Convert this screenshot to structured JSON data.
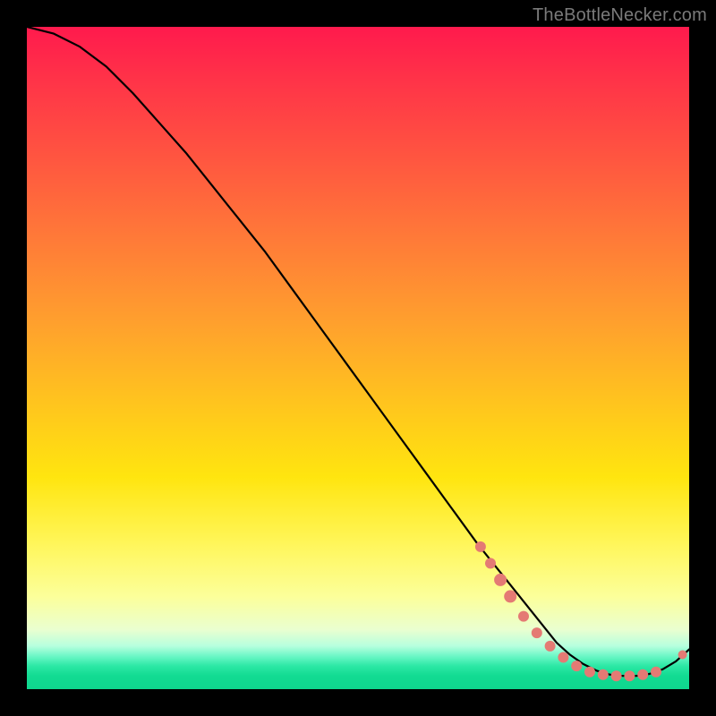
{
  "watermark": "TheBottleNecker.com",
  "colors": {
    "curve": "#000000",
    "marker_fill": "#e47a74",
    "marker_stroke": "#c95b55"
  },
  "chart_data": {
    "type": "line",
    "title": "",
    "xlabel": "",
    "ylabel": "",
    "xlim": [
      0,
      100
    ],
    "ylim": [
      0,
      100
    ],
    "grid": false,
    "legend": false,
    "series": [
      {
        "name": "curve",
        "x": [
          0,
          4,
          8,
          12,
          16,
          20,
          24,
          28,
          32,
          36,
          40,
          44,
          48,
          52,
          56,
          60,
          64,
          68,
          72,
          76,
          80,
          82,
          84,
          86,
          88,
          90,
          92,
          94,
          96,
          98,
          100
        ],
        "values": [
          100,
          99,
          97,
          94,
          90,
          85.5,
          81,
          76,
          71,
          66,
          60.5,
          55,
          49.5,
          44,
          38.5,
          33,
          27.5,
          22,
          17,
          12,
          7,
          5.2,
          3.8,
          2.8,
          2.2,
          2.0,
          2.0,
          2.3,
          3.0,
          4.2,
          6.0
        ]
      }
    ],
    "markers": [
      {
        "x": 68.5,
        "y": 21.5,
        "r": 6
      },
      {
        "x": 70.0,
        "y": 19.0,
        "r": 6
      },
      {
        "x": 71.5,
        "y": 16.5,
        "r": 7
      },
      {
        "x": 73.0,
        "y": 14.0,
        "r": 7
      },
      {
        "x": 75.0,
        "y": 11.0,
        "r": 6
      },
      {
        "x": 77.0,
        "y": 8.5,
        "r": 6
      },
      {
        "x": 79.0,
        "y": 6.5,
        "r": 6
      },
      {
        "x": 81.0,
        "y": 4.8,
        "r": 6
      },
      {
        "x": 83.0,
        "y": 3.5,
        "r": 6
      },
      {
        "x": 85.0,
        "y": 2.6,
        "r": 6
      },
      {
        "x": 87.0,
        "y": 2.2,
        "r": 6
      },
      {
        "x": 89.0,
        "y": 2.0,
        "r": 6
      },
      {
        "x": 91.0,
        "y": 2.0,
        "r": 6
      },
      {
        "x": 93.0,
        "y": 2.2,
        "r": 6
      },
      {
        "x": 95.0,
        "y": 2.6,
        "r": 6
      },
      {
        "x": 99.0,
        "y": 5.2,
        "r": 5
      }
    ]
  }
}
